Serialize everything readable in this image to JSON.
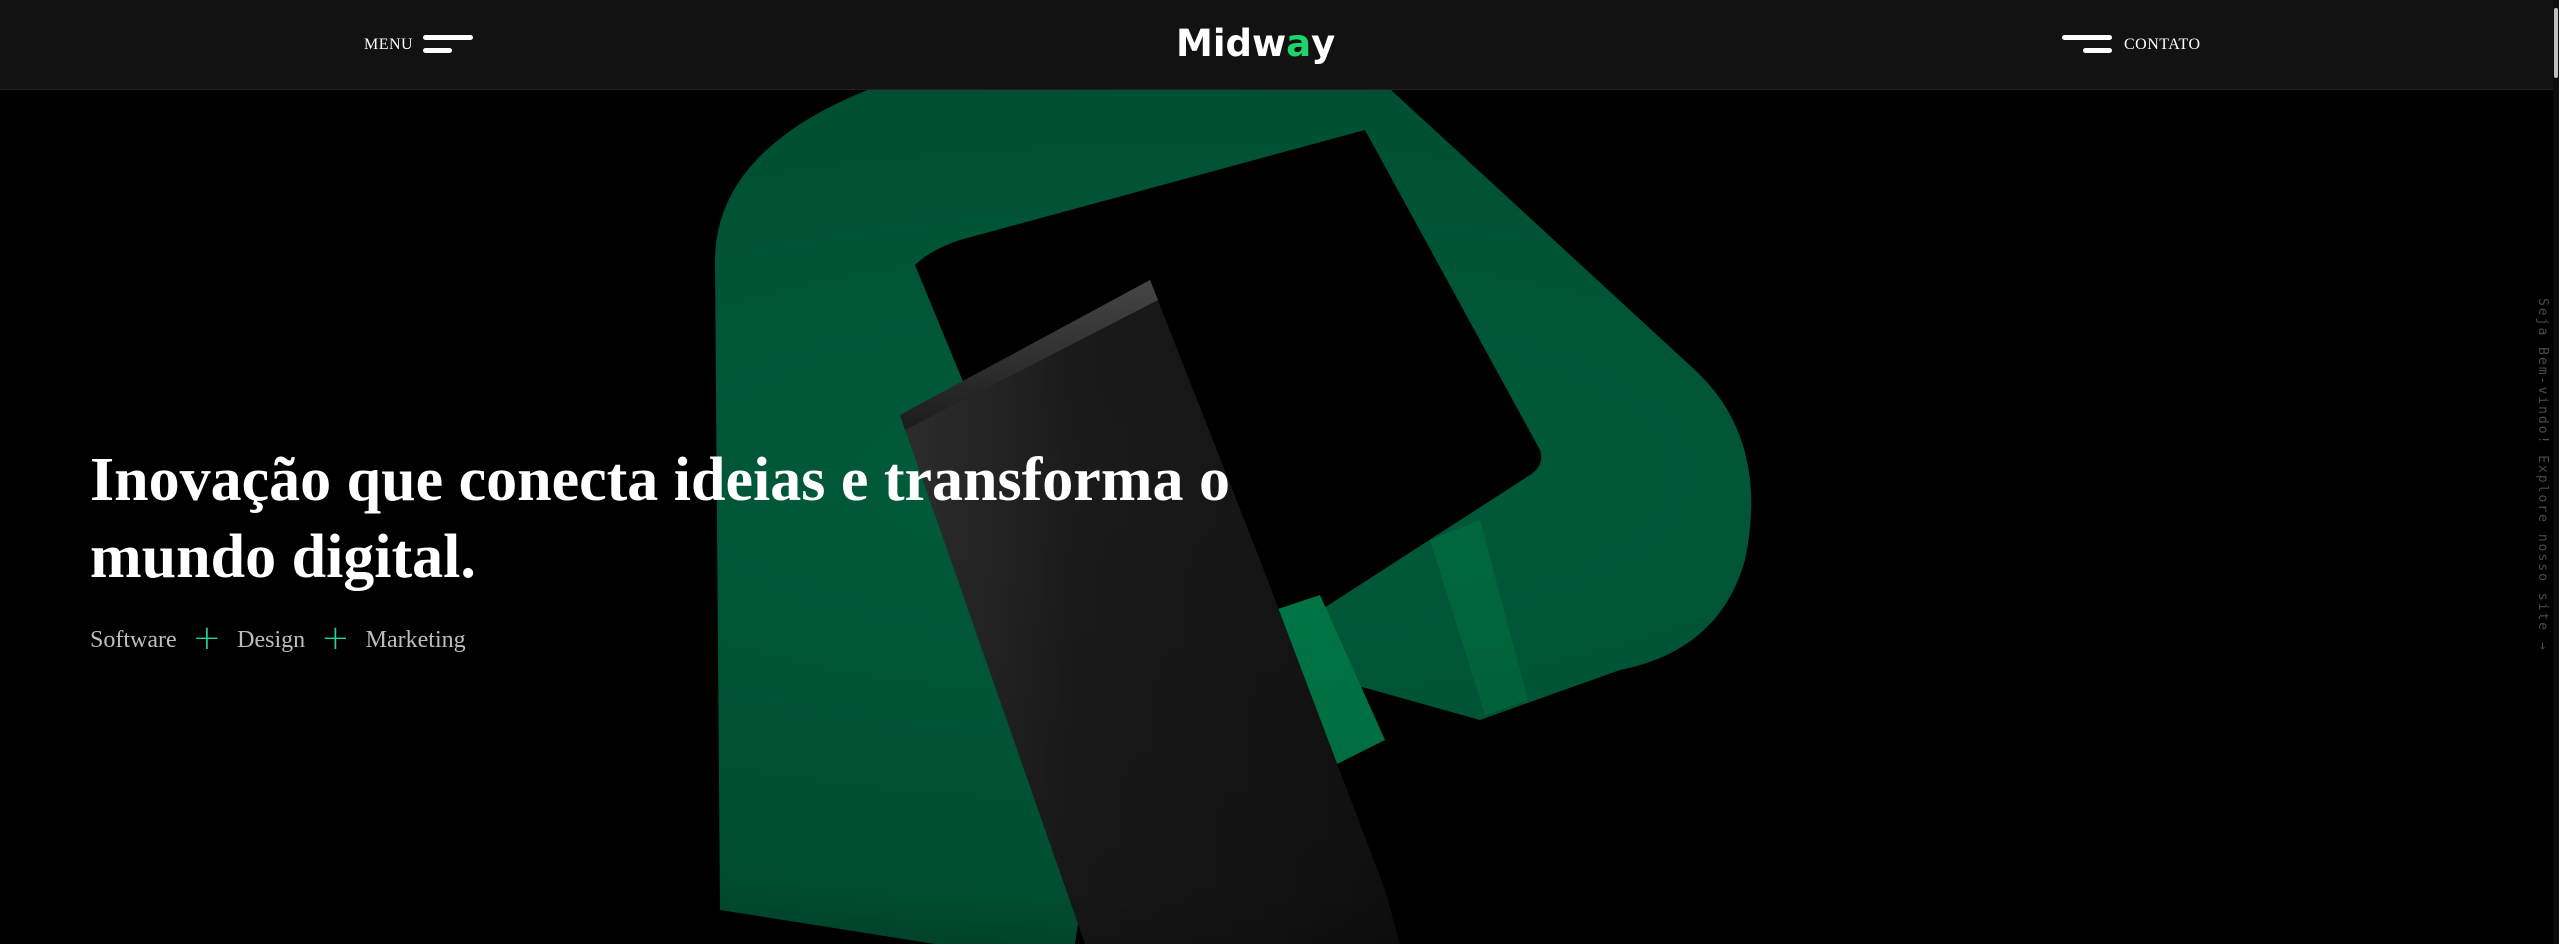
{
  "header": {
    "menu_label": "MENU",
    "logo": {
      "prefix": "Midw",
      "accent": "a",
      "suffix": "y"
    },
    "contact_label": "CONTATO"
  },
  "hero": {
    "headline": "Inovação que conecta ideias e transforma o mundo digital.",
    "services": [
      "Software",
      "Design",
      "Marketing"
    ],
    "separator_icon": "plus-icon",
    "side_text": "Seja Bem-vindo! Explore nosso site →"
  },
  "colors": {
    "header_bg": "#121212",
    "brand_green": "#1fd36b",
    "logo_green_dark": "#005c3b",
    "plus_color": "#1fd3a0",
    "background": "#000000"
  }
}
